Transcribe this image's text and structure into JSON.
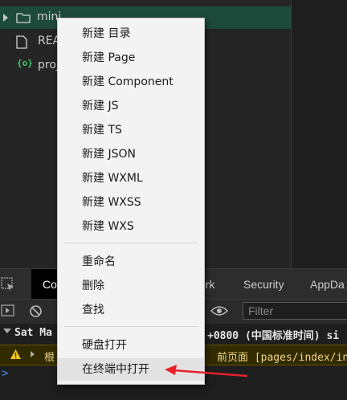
{
  "file_tree": {
    "items": [
      {
        "label": "mini",
        "icon": "folder-icon",
        "selected": true
      },
      {
        "label": "REA",
        "icon": "file-icon"
      },
      {
        "label": "proj",
        "icon": "json-icon",
        "icon_text": "{o}"
      }
    ]
  },
  "devtools": {
    "tabs": [
      {
        "label": "Co",
        "active": true
      },
      {
        "label": "ork"
      },
      {
        "label": "Security"
      },
      {
        "label": "AppDa"
      }
    ],
    "filter_placeholder": "Filter"
  },
  "console": {
    "date_left": "Sat Ma",
    "date_right": "+0800 (中国标准时间) si",
    "warn_left": "根",
    "warn_right": "前页面 [pages/index/in",
    "prompt": ">"
  },
  "context_menu": {
    "groups": [
      [
        "新建 目录",
        "新建 Page",
        "新建 Component",
        "新建 JS",
        "新建 TS",
        "新建 JSON",
        "新建 WXML",
        "新建 WXSS",
        "新建 WXS"
      ],
      [
        "重命名",
        "删除",
        "查找"
      ],
      [
        "硬盘打开",
        "在终端中打开"
      ]
    ]
  },
  "colors": {
    "selected_row": "#1e4a3b",
    "annotation_arrow": "#e8212a",
    "warning": "#f5c518",
    "menu_background": "#f3f3f3"
  }
}
